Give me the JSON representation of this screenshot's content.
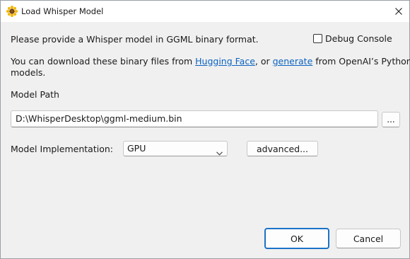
{
  "window": {
    "title": "Load Whisper Model",
    "icon": "sunflower-icon"
  },
  "intro": {
    "line1": "Please provide a Whisper model in GGML binary format.",
    "line2_prefix": "You can download these binary files from ",
    "hugging_face_link": "Hugging Face",
    "line2_middle": ", or ",
    "generate_link": "generate",
    "line2_suffix": " from OpenAI’s Python",
    "line3": "models."
  },
  "debug_console": {
    "label": "Debug Console",
    "checked": false
  },
  "model_path": {
    "label": "Model Path",
    "value": "D:\\WhisperDesktop\\ggml-medium.bin",
    "browse_label": "..."
  },
  "implementation": {
    "label": "Model Implementation:",
    "selected": "GPU",
    "advanced_label": "advanced..."
  },
  "buttons": {
    "ok": "OK",
    "cancel": "Cancel"
  },
  "colors": {
    "link": "#0b63c1",
    "default_button_border": "#1a73c8",
    "dialog_background": "#f0f0f0"
  }
}
